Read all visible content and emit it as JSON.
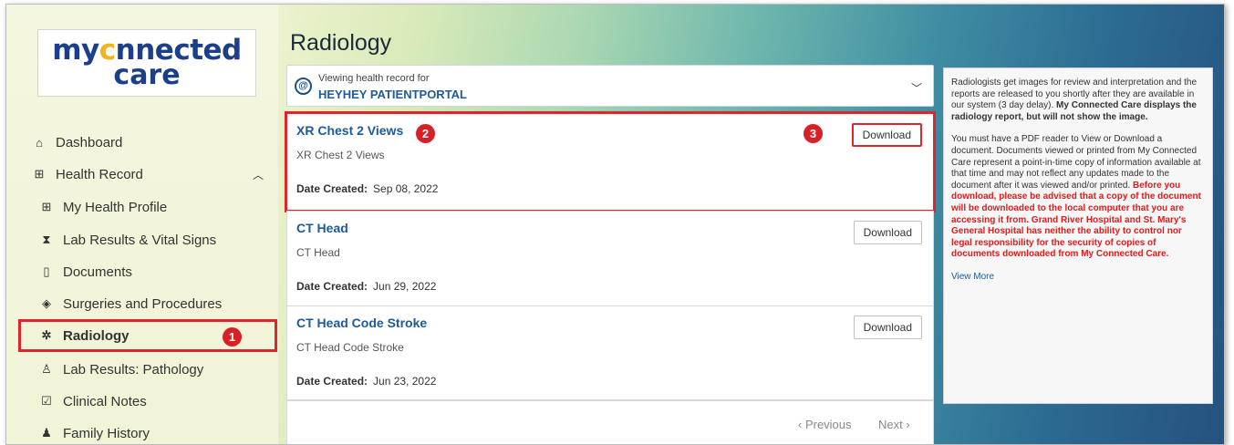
{
  "logo": {
    "line1_a": "my",
    "line1_o": "c",
    "line1_b": "nnected",
    "line2": "care"
  },
  "sidebar": {
    "items": [
      {
        "label": "Dashboard",
        "icon": "home-icon",
        "glyph": "⌂"
      },
      {
        "label": "Health Record",
        "icon": "health-record-icon",
        "glyph": "⊞"
      },
      {
        "label": "My Health Profile",
        "icon": "profile-icon",
        "glyph": "⊞"
      },
      {
        "label": "Lab Results & Vital Signs",
        "icon": "hourglass-icon",
        "glyph": "⧗"
      },
      {
        "label": "Documents",
        "icon": "document-icon",
        "glyph": "▯"
      },
      {
        "label": "Surgeries and Procedures",
        "icon": "bandage-icon",
        "glyph": "◈"
      },
      {
        "label": "Radiology",
        "icon": "radiology-icon",
        "glyph": "✲"
      },
      {
        "label": "Lab Results: Pathology",
        "icon": "microscope-icon",
        "glyph": "♙"
      },
      {
        "label": "Clinical Notes",
        "icon": "clipboard-icon",
        "glyph": "☑"
      },
      {
        "label": "Family History",
        "icon": "family-icon",
        "glyph": "♟"
      }
    ]
  },
  "main": {
    "title": "Radiology",
    "viewing": {
      "label": "Viewing health record for",
      "patient": "HEYHEY PATIENTPORTAL"
    },
    "date_label": "Date Created:",
    "download_label": "Download",
    "records": [
      {
        "title": "XR Chest 2 Views",
        "subtitle": "XR Chest 2 Views",
        "date": "Sep 08, 2022"
      },
      {
        "title": "CT Head",
        "subtitle": "CT Head",
        "date": "Jun 29, 2022"
      },
      {
        "title": "CT Head Code Stroke",
        "subtitle": "CT Head Code Stroke",
        "date": "Jun 23, 2022"
      }
    ],
    "pager": {
      "prev": "‹  Previous",
      "next": "Next  ›"
    }
  },
  "badges": {
    "b1": "1",
    "b2": "2",
    "b3": "3"
  },
  "info": {
    "p1_normal": "Radiologists get images for review and interpretation and the reports are released to you shortly after they are available in our system (3 day delay). ",
    "p1_bold": "My Connected Care displays the radiology report, but will not show the image.",
    "p2_normal": "You must have a PDF reader to View or Download a document. Documents viewed or printed from My Connected Care represent a point-in-time copy of information available at that time and may not reflect any updates made to the document after it was viewed and/or printed.  ",
    "p2_red": "Before you download, please be advised that a copy of the document will be downloaded to the local computer that you are accessing it from. Grand River Hospital and St. Mary's General Hospital has neither the ability to control nor legal responsibility for the security of copies of documents downloaded from My Connected Care.",
    "view_more": "View More"
  },
  "colors": {
    "highlight": "#e0242d",
    "link": "#1d5a9a",
    "brand": "#1b3f8a",
    "accent": "#f2b41c"
  }
}
